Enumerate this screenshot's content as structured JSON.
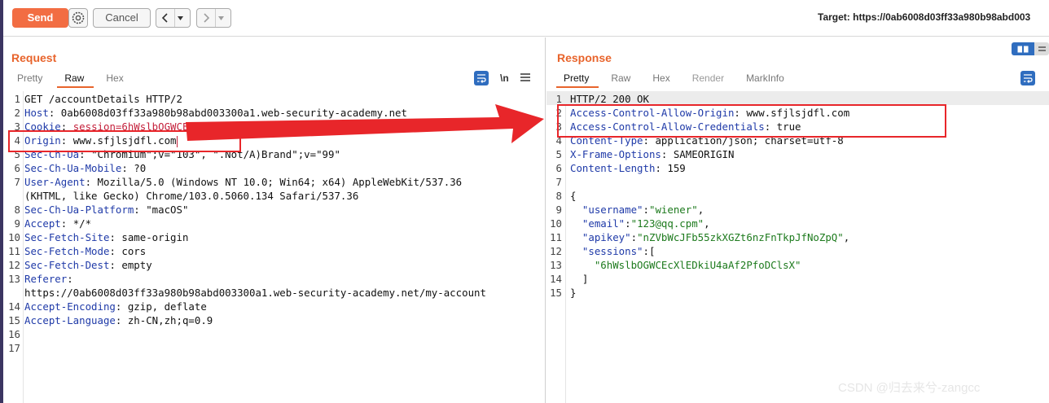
{
  "toolbar": {
    "send_label": "Send",
    "cancel_label": "Cancel",
    "target_text": "Target: https://0ab6008d03ff33a980b98abd003"
  },
  "request": {
    "title": "Request",
    "tabs": [
      "Pretty",
      "Raw",
      "Hex"
    ],
    "active_tab": "Raw",
    "newline_toggle": "\\n",
    "lines": [
      {
        "n": "1",
        "code": "GET /accountDetails HTTP/2"
      },
      {
        "n": "2",
        "key": "Host",
        "value": " 0ab6008d03ff33a980b98abd003300a1.web-security-academy.net"
      },
      {
        "n": "3",
        "key": "Cookie",
        "value": " session=6hWslbOGWCEcXlEDkiU4aAf2PfoDClsX",
        "value_color": "red"
      },
      {
        "n": "4",
        "key": "Origin",
        "value": " www.sfjlsjdfl.com"
      },
      {
        "n": "5",
        "key": "Sec-Ch-Ua",
        "value": " \"Chromium\";v=\"103\", \".Not/A)Brand\";v=\"99\""
      },
      {
        "n": "6",
        "key": "Sec-Ch-Ua-Mobile",
        "value": " ?0"
      },
      {
        "n": "7",
        "key": "User-Agent",
        "value": " Mozilla/5.0 (Windows NT 10.0; Win64; x64) AppleWebKit/537.36"
      },
      {
        "n": "",
        "code": "(KHTML, like Gecko) Chrome/103.0.5060.134 Safari/537.36"
      },
      {
        "n": "8",
        "key": "Sec-Ch-Ua-Platform",
        "value": " \"macOS\""
      },
      {
        "n": "9",
        "key": "Accept",
        "value": " */*"
      },
      {
        "n": "10",
        "key": "Sec-Fetch-Site",
        "value": " same-origin"
      },
      {
        "n": "11",
        "key": "Sec-Fetch-Mode",
        "value": " cors"
      },
      {
        "n": "12",
        "key": "Sec-Fetch-Dest",
        "value": " empty"
      },
      {
        "n": "13",
        "key": "Referer",
        "value": ""
      },
      {
        "n": "",
        "code": "https://0ab6008d03ff33a980b98abd003300a1.web-security-academy.net/my-account"
      },
      {
        "n": "14",
        "key": "Accept-Encoding",
        "value": " gzip, deflate"
      },
      {
        "n": "15",
        "key": "Accept-Language",
        "value": " zh-CN,zh;q=0.9"
      },
      {
        "n": "16",
        "code": ""
      },
      {
        "n": "17",
        "code": ""
      }
    ]
  },
  "response": {
    "title": "Response",
    "tabs": [
      "Pretty",
      "Raw",
      "Hex",
      "Render",
      "MarkInfo"
    ],
    "active_tab": "Pretty",
    "disabled_tab": "Render",
    "lines": [
      {
        "n": "1",
        "code": "HTTP/2 200 OK"
      },
      {
        "n": "2",
        "key": "Access-Control-Allow-Origin",
        "value": " www.sfjlsjdfl.com"
      },
      {
        "n": "3",
        "key": "Access-Control-Allow-Credentials",
        "value": " true"
      },
      {
        "n": "4",
        "key": "Content-Type",
        "value": " application/json; charset=utf-8"
      },
      {
        "n": "5",
        "key": "X-Frame-Options",
        "value": " SAMEORIGIN"
      },
      {
        "n": "6",
        "key": "Content-Length",
        "value": " 159"
      },
      {
        "n": "7",
        "code": ""
      },
      {
        "n": "8",
        "code": "{"
      },
      {
        "n": "9",
        "jkey": "\"username\"",
        "jval": "\"wiener\"",
        "tail": ","
      },
      {
        "n": "10",
        "jkey": "\"email\"",
        "jval": "\"123@qq.cpm\"",
        "tail": ","
      },
      {
        "n": "11",
        "jkey": "\"apikey\"",
        "jval": "\"nZVbWcJFb55zkXGZt6nzFnTkpJfNoZpQ\"",
        "tail": ","
      },
      {
        "n": "12",
        "jkey": "\"sessions\"",
        "jval": "[",
        "tail": ""
      },
      {
        "n": "13",
        "jstr": "\"6hWslbOGWCEcXlEDkiU4aAf2PfoDClsX\""
      },
      {
        "n": "14",
        "code": "  ]"
      },
      {
        "n": "15",
        "code": "}"
      }
    ]
  },
  "watermark": "CSDN @归去来兮-zangcc",
  "colors": {
    "accent": "#f26d43",
    "title": "#e8642c",
    "header_key": "#1f3aa8",
    "cookie_value": "#c41f3a",
    "json_string": "#1d7a1d",
    "annotation": "#e8262a"
  }
}
